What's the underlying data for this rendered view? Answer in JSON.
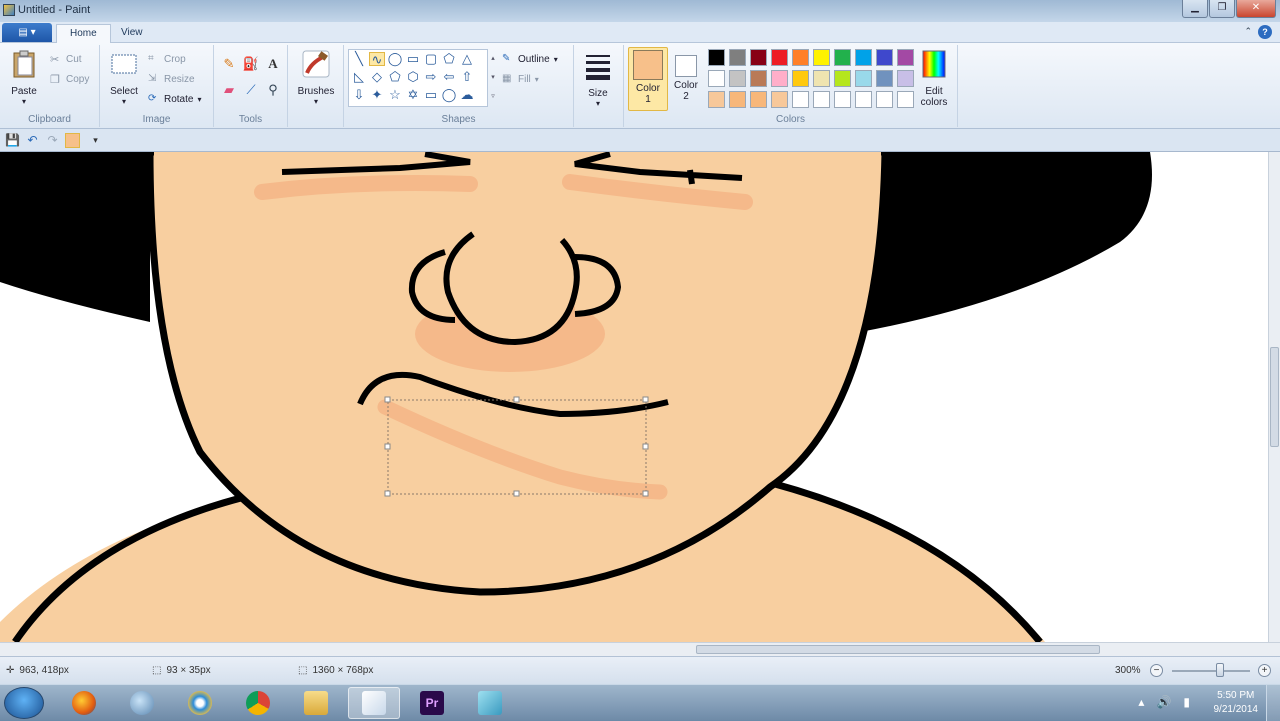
{
  "window": {
    "title": "Untitled - Paint"
  },
  "tabs": {
    "menu_label": "▤ ▾",
    "home": "Home",
    "view": "View"
  },
  "clipboard": {
    "paste": "Paste",
    "cut": "Cut",
    "copy": "Copy",
    "label": "Clipboard"
  },
  "image": {
    "select": "Select",
    "crop": "Crop",
    "resize": "Resize",
    "rotate": "Rotate",
    "label": "Image"
  },
  "tools": {
    "label": "Tools"
  },
  "brushes": {
    "label": "Brushes"
  },
  "shapes": {
    "outline": "Outline",
    "fill": "Fill",
    "label": "Shapes"
  },
  "size": {
    "label": "Size"
  },
  "colors": {
    "color1": "Color\n1",
    "color2": "Color\n2",
    "edit": "Edit colors",
    "label": "Colors",
    "color1_value": "#f7c08a",
    "color2_value": "#ffffff",
    "palette_row1": [
      "#000000",
      "#7f7f7f",
      "#880015",
      "#ed1c24",
      "#ff7f27",
      "#fff200",
      "#22b14c",
      "#00a2e8",
      "#3f48cc",
      "#a349a4"
    ],
    "palette_row2": [
      "#ffffff",
      "#c3c3c3",
      "#b97a57",
      "#ffaec9",
      "#ffc90e",
      "#efe4b0",
      "#b5e61d",
      "#99d9ea",
      "#7092be",
      "#c8bfe7"
    ],
    "palette_row3": [
      "#f7c89a",
      "#f7b77a",
      "#f7b77a",
      "#f7c89a",
      "#ffffff",
      "#ffffff",
      "#ffffff",
      "#ffffff",
      "#ffffff",
      "#ffffff"
    ]
  },
  "status": {
    "cursor": "963, 418px",
    "selection": "93 × 35px",
    "image_size": "1360 × 768px",
    "zoom": "300%"
  },
  "clock": {
    "time": "5:50 PM",
    "date": "9/21/2014"
  }
}
